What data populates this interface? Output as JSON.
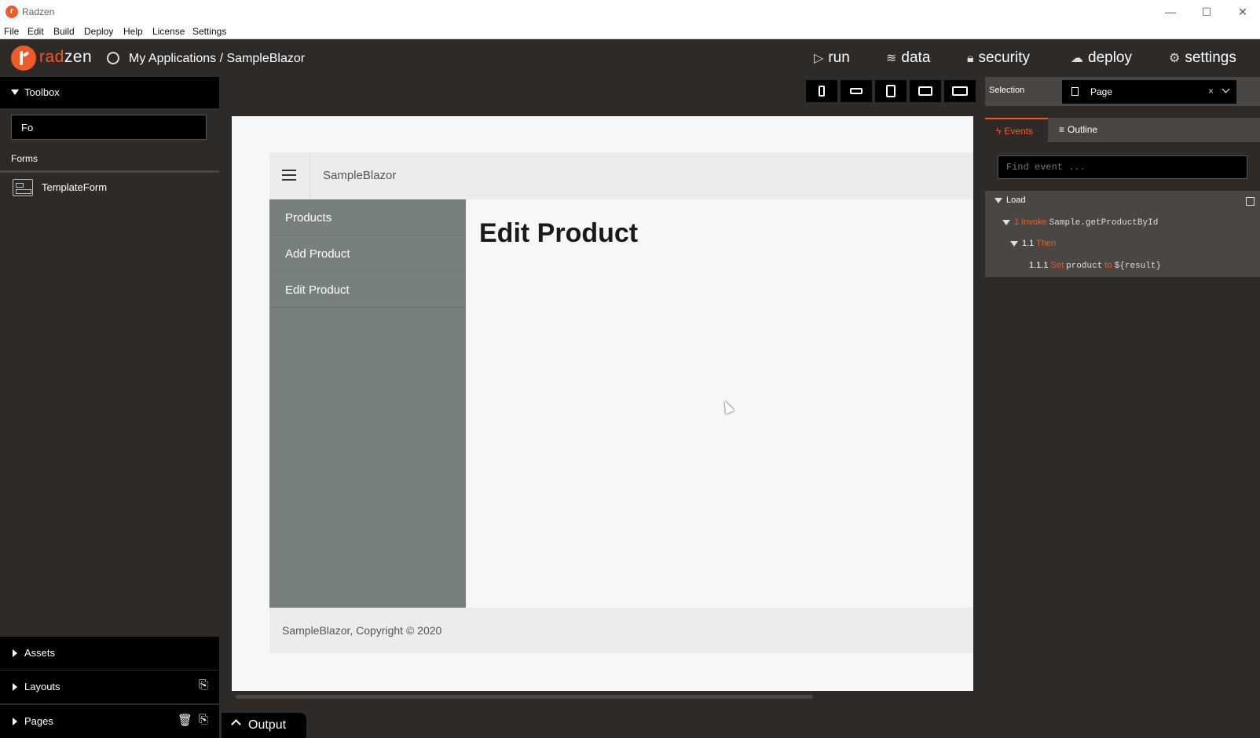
{
  "window": {
    "title": "Radzen",
    "minimize": "—",
    "maximize": "☐",
    "close": "✕"
  },
  "menu": [
    "File",
    "Edit",
    "Build",
    "Deploy",
    "Help",
    "License",
    "Settings"
  ],
  "header": {
    "brand_accent": "rad",
    "brand_rest": "zen",
    "breadcrumb": "My Applications / SampleBlazor",
    "nav": [
      {
        "label": "run",
        "icon": "play-icon"
      },
      {
        "label": "data",
        "icon": "layers-icon"
      },
      {
        "label": "security",
        "icon": "lock-icon"
      },
      {
        "label": "deploy",
        "icon": "cloud-upload-icon"
      },
      {
        "label": "settings",
        "icon": "gear-icon"
      }
    ]
  },
  "toolbox": {
    "title": "Toolbox",
    "search_value": "Fo",
    "category": "Forms",
    "items": [
      {
        "label": "TemplateForm"
      }
    ]
  },
  "sections": {
    "assets": "Assets",
    "layouts": "Layouts",
    "pages": "Pages"
  },
  "preview": {
    "app_name": "SampleBlazor",
    "sidebar": [
      "Products",
      "Add Product",
      "Edit Product"
    ],
    "page_title": "Edit Product",
    "footer": "SampleBlazor, Copyright © 2020"
  },
  "output": {
    "label": "Output"
  },
  "right": {
    "selection_label": "Selection",
    "selection_value": "Page",
    "clear": "×",
    "tabs": {
      "events": "Events",
      "outline": "Outline"
    },
    "find_placeholder": "Find event ...",
    "tree": {
      "event": "Load",
      "step1_num": "1",
      "step1_kw": "Invoke",
      "step1_text": "Sample.getProductById",
      "step11_num": "1.1",
      "step11_kw": "Then",
      "step111_num": "1.1.1",
      "step111_kw": "Set",
      "step111_a": "product",
      "step111_kw2": "to",
      "step111_b": "${result}"
    }
  },
  "colors": {
    "accent": "#f05a28",
    "dark": "#2d2a28",
    "sidebar": "#77807f"
  }
}
